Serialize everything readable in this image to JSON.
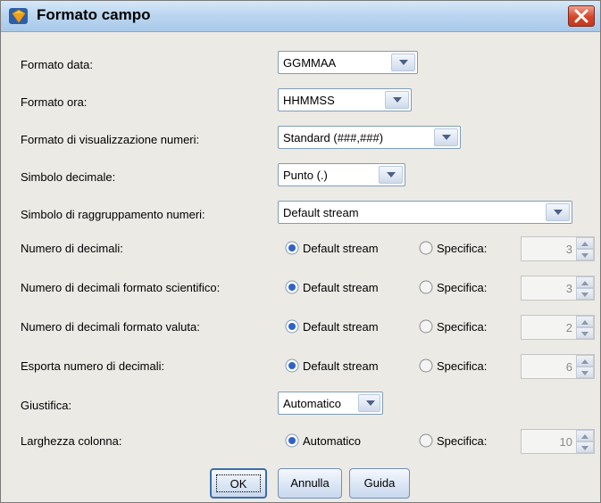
{
  "window": {
    "title": "Formato campo",
    "close_label": "✕"
  },
  "rows": {
    "date_format": {
      "label": "Formato data:",
      "value": "GGMMAA"
    },
    "time_format": {
      "label": "Formato ora:",
      "value": "HHMMSS"
    },
    "number_display": {
      "label": "Formato di visualizzazione numeri:",
      "value": "Standard (###,###)"
    },
    "decimal_symbol": {
      "label": "Simbolo decimale:",
      "value": "Punto (.)"
    },
    "grouping_symbol": {
      "label": "Simbolo di raggruppamento numeri:",
      "value": "Default stream"
    },
    "num_decimals": {
      "label": "Numero di decimali:",
      "option_default": "Default stream",
      "option_specify": "Specifica:",
      "selected": "default",
      "spin_value": "3"
    },
    "sci_decimals": {
      "label": "Numero di decimali formato scientifico:",
      "option_default": "Default stream",
      "option_specify": "Specifica:",
      "selected": "default",
      "spin_value": "3"
    },
    "currency_decimals": {
      "label": "Numero di decimali formato valuta:",
      "option_default": "Default stream",
      "option_specify": "Specifica:",
      "selected": "default",
      "spin_value": "2"
    },
    "export_decimals": {
      "label": "Esporta numero di decimali:",
      "option_default": "Default stream",
      "option_specify": "Specifica:",
      "selected": "default",
      "spin_value": "6"
    },
    "justify": {
      "label": "Giustifica:",
      "value": "Automatico"
    },
    "column_width": {
      "label": "Larghezza colonna:",
      "option_default": "Automatico",
      "option_specify": "Specifica:",
      "selected": "default",
      "spin_value": "10"
    }
  },
  "buttons": {
    "ok": "OK",
    "cancel": "Annulla",
    "help": "Guida"
  },
  "colors": {
    "title_bar": "#bcd6f0",
    "close_button": "#d2452a",
    "dialog_bg": "#eceae5",
    "radio_selected": "#2f63c4"
  }
}
